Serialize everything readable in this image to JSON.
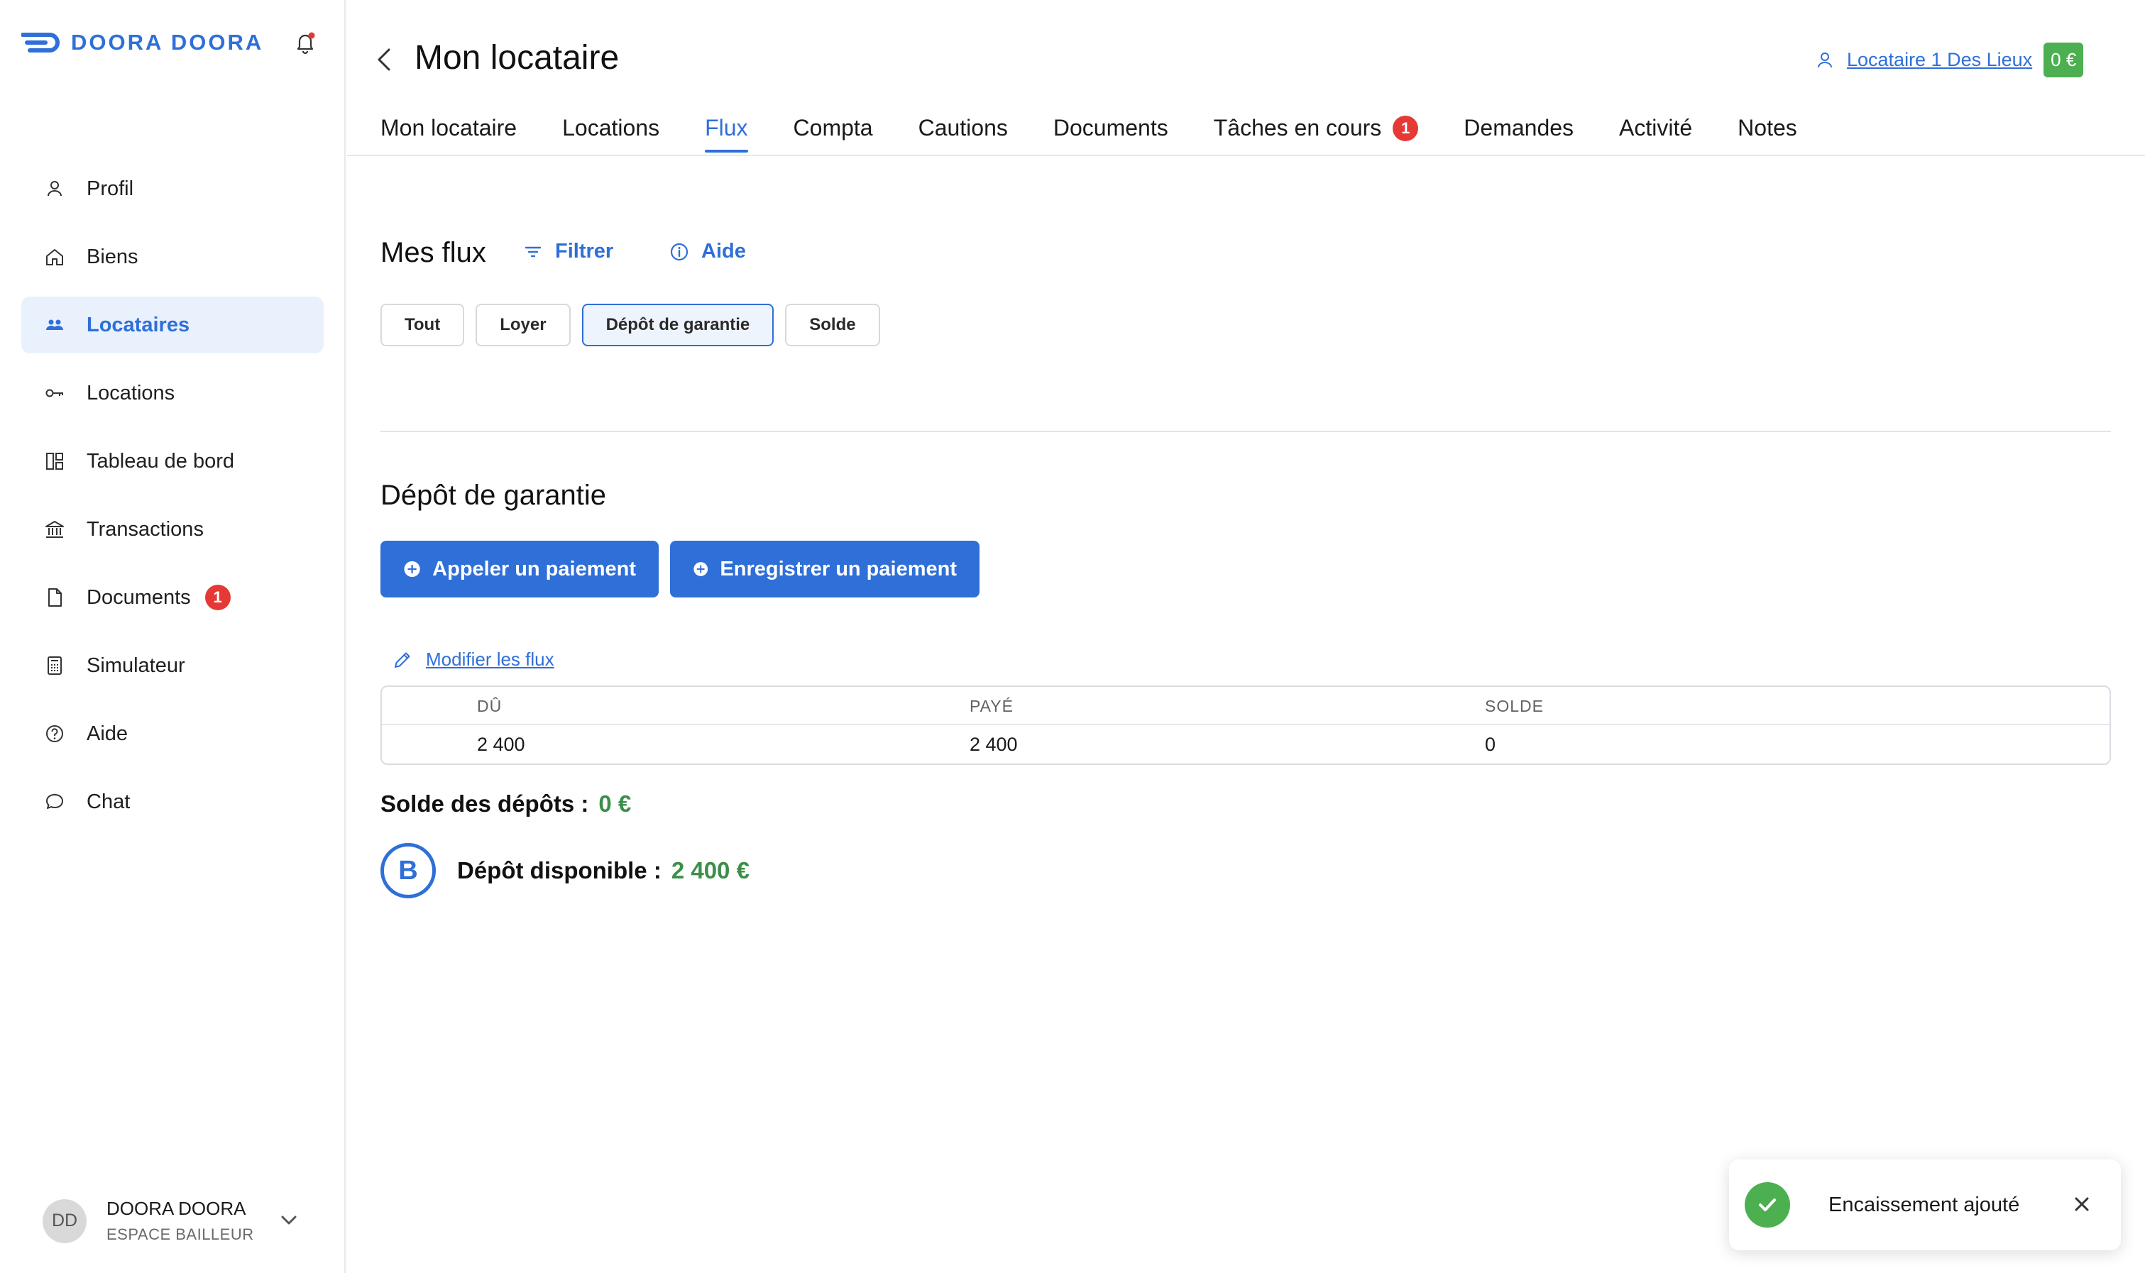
{
  "app": {
    "brand": "DOORA DOORA",
    "accent_color": "#2f6fd8",
    "success_color": "#4caf50",
    "badge_color": "#e53935"
  },
  "sidebar": {
    "items": [
      {
        "label": "Profil",
        "icon": "user-icon"
      },
      {
        "label": "Biens",
        "icon": "home-icon"
      },
      {
        "label": "Locataires",
        "icon": "users-icon",
        "active": true
      },
      {
        "label": "Locations",
        "icon": "key-icon"
      },
      {
        "label": "Tableau de bord",
        "icon": "dashboard-icon"
      },
      {
        "label": "Transactions",
        "icon": "bank-icon"
      },
      {
        "label": "Documents",
        "icon": "document-icon",
        "badge": "1"
      },
      {
        "label": "Simulateur",
        "icon": "calculator-icon"
      },
      {
        "label": "Aide",
        "icon": "help-icon"
      },
      {
        "label": "Chat",
        "icon": "chat-icon"
      }
    ],
    "user": {
      "initials": "DD",
      "name": "DOORA DOORA",
      "role": "ESPACE BAILLEUR"
    }
  },
  "header": {
    "title": "Mon locataire",
    "tenant_link": "Locataire 1 Des Lieux",
    "tenant_balance": "0 €"
  },
  "tabs": [
    {
      "label": "Mon locataire"
    },
    {
      "label": "Locations"
    },
    {
      "label": "Flux",
      "active": true
    },
    {
      "label": "Compta"
    },
    {
      "label": "Cautions"
    },
    {
      "label": "Documents"
    },
    {
      "label": "Tâches en cours",
      "badge": "1"
    },
    {
      "label": "Demandes"
    },
    {
      "label": "Activité"
    },
    {
      "label": "Notes"
    }
  ],
  "flux": {
    "title": "Mes flux",
    "filter_label": "Filtrer",
    "help_label": "Aide",
    "chips": [
      {
        "label": "Tout"
      },
      {
        "label": "Loyer"
      },
      {
        "label": "Dépôt de garantie",
        "active": true
      },
      {
        "label": "Solde"
      }
    ]
  },
  "deposit": {
    "title": "Dépôt de garantie",
    "call_payment": "Appeler un paiement",
    "record_payment": "Enregistrer un paiement",
    "modify_link": "Modifier les flux",
    "table": {
      "headers": [
        "DÛ",
        "PAYÉ",
        "SOLDE"
      ],
      "rows": [
        [
          "2 400",
          "2 400",
          "0"
        ]
      ]
    },
    "balance_label": "Solde des dépôts :",
    "balance_value": "0 €",
    "available_badge": "B",
    "available_label": "Dépôt disponible :",
    "available_value": "2 400 €"
  },
  "toast": {
    "message": "Encaissement ajouté"
  }
}
